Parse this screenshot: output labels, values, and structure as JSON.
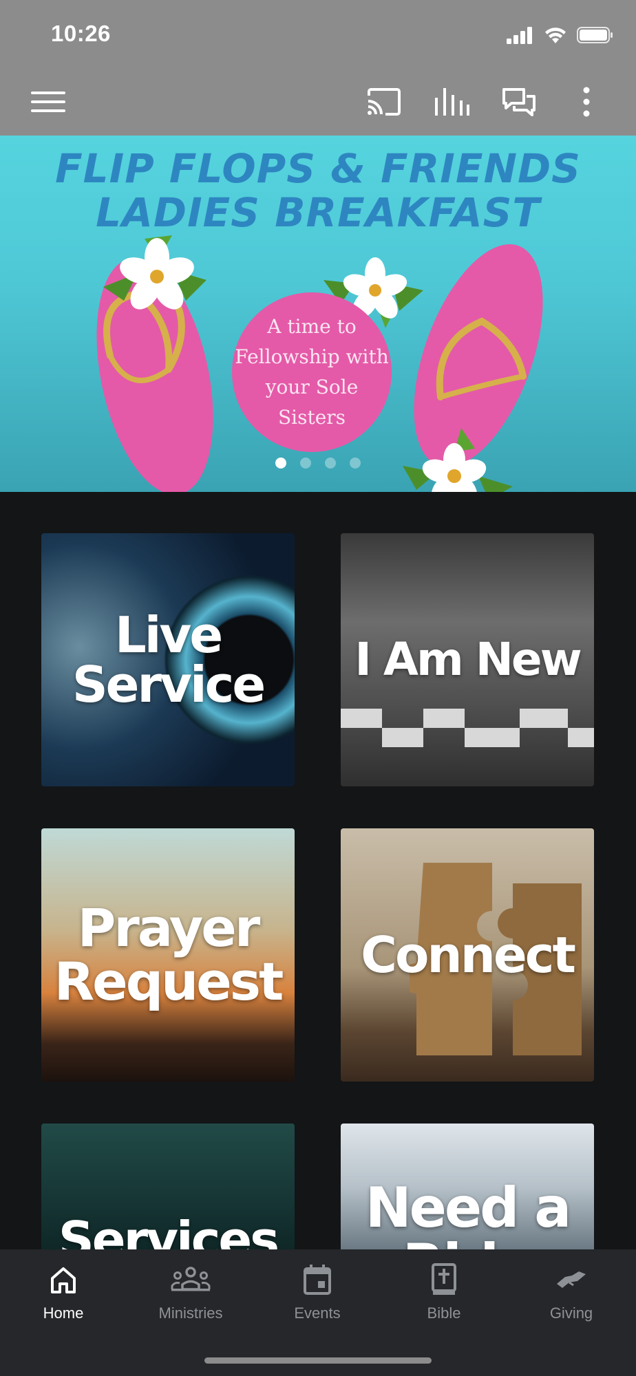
{
  "status_bar": {
    "time": "10:26"
  },
  "app_bar": {
    "menu_icon": "hamburger-menu-icon",
    "actions": [
      "cast-icon",
      "equalizer-icon",
      "chat-icon",
      "more-vert-icon"
    ]
  },
  "banner": {
    "title_line1": "FLIP FLOPS & FRIENDS",
    "title_line2": "LADIES BREAKFAST",
    "circle_text": "A time to Fellowship with your Sole Sisters",
    "slide_count": 4,
    "active_slide": 1
  },
  "tiles": [
    {
      "label": "Live Service"
    },
    {
      "label": "I Am New"
    },
    {
      "label": "Prayer Request"
    },
    {
      "label": "Connect"
    },
    {
      "label": "Services"
    },
    {
      "label": "Need a Ride"
    }
  ],
  "tabs": [
    {
      "label": "Home",
      "icon": "home-icon",
      "active": true
    },
    {
      "label": "Ministries",
      "icon": "people-icon"
    },
    {
      "label": "Events",
      "icon": "calendar-icon"
    },
    {
      "label": "Bible",
      "icon": "bible-icon"
    },
    {
      "label": "Giving",
      "icon": "handshake-icon"
    }
  ],
  "colors": {
    "status_bar": "#8c8c8c",
    "background": "#131517",
    "tab_bar": "#25272a",
    "banner_title": "#2e86c1",
    "flip_flop_pink": "#e45aa8"
  }
}
